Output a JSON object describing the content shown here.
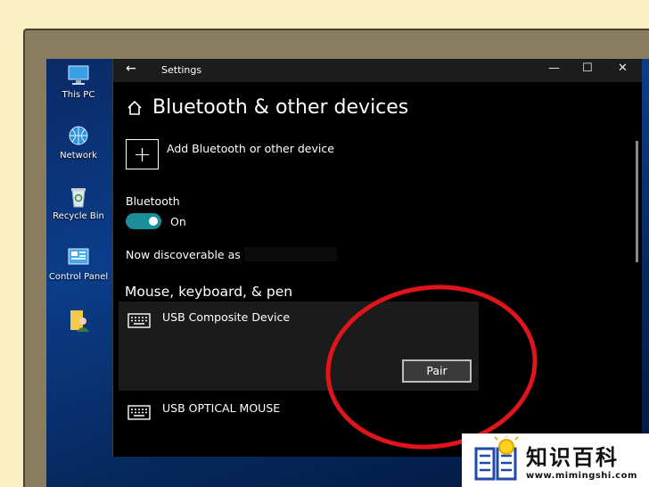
{
  "desktop": {
    "icons": [
      {
        "label": "This PC",
        "icon": "computer-icon"
      },
      {
        "label": "Network",
        "icon": "network-icon"
      },
      {
        "label": "Recycle Bin",
        "icon": "recycle-bin-icon"
      },
      {
        "label": "Control Panel",
        "icon": "control-panel-icon"
      },
      {
        "label": "",
        "icon": "user-folder-icon"
      }
    ]
  },
  "window": {
    "title": "Settings",
    "back_glyph": "←",
    "minimize_glyph": "—",
    "maximize_glyph": "☐",
    "close_glyph": "✕",
    "page_title": "Bluetooth & other devices",
    "add_device_label": "Add Bluetooth or other device",
    "bluetooth_label": "Bluetooth",
    "bluetooth_state": "On",
    "discoverable_text": "Now discoverable as",
    "section_title": "Mouse, keyboard, & pen",
    "devices": [
      {
        "name": "USB Composite Device",
        "action": "Pair"
      },
      {
        "name": "USB OPTICAL MOUSE"
      }
    ]
  },
  "colors": {
    "accent_toggle": "#1a8f99",
    "annotation_circle": "#e0141b",
    "background": "#fcefc1"
  },
  "watermark": {
    "title": "知识百科",
    "url": "www.mimingshi.com"
  }
}
